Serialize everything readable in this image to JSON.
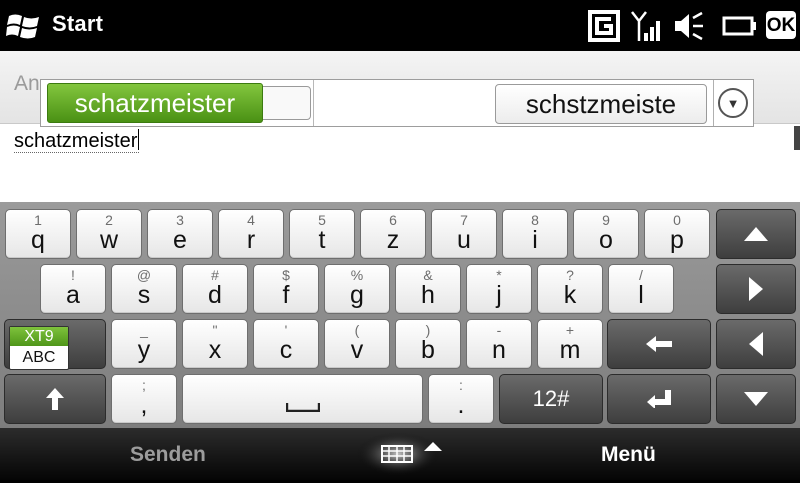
{
  "statusbar": {
    "title": "Start",
    "icons": [
      "windows-start-icon",
      "gprs-icon",
      "signal-strength-icon",
      "speaker-muted-icon",
      "battery-icon",
      "ok-button"
    ],
    "ok_label": "OK"
  },
  "recipient": {
    "label": "An",
    "suggestion_primary": "schatzmeister",
    "suggestion_secondary": "schstzmeiste",
    "more_icon": "chevron-down-circle-icon"
  },
  "message": {
    "text": "schatzmeister"
  },
  "keyboard": {
    "rows": [
      [
        {
          "name": "q",
          "sec": "1",
          "pri": "q"
        },
        {
          "name": "w",
          "sec": "2",
          "pri": "w"
        },
        {
          "name": "e",
          "sec": "3",
          "pri": "e"
        },
        {
          "name": "r",
          "sec": "4",
          "pri": "r"
        },
        {
          "name": "t",
          "sec": "5",
          "pri": "t"
        },
        {
          "name": "z",
          "sec": "6",
          "pri": "z"
        },
        {
          "name": "u",
          "sec": "7",
          "pri": "u"
        },
        {
          "name": "i",
          "sec": "8",
          "pri": "i"
        },
        {
          "name": "o",
          "sec": "9",
          "pri": "o"
        },
        {
          "name": "p",
          "sec": "0",
          "pri": "p"
        }
      ],
      [
        {
          "name": "a",
          "sec": "!",
          "pri": "a"
        },
        {
          "name": "s",
          "sec": "@",
          "pri": "s"
        },
        {
          "name": "d",
          "sec": "#",
          "pri": "d"
        },
        {
          "name": "f",
          "sec": "$",
          "pri": "f"
        },
        {
          "name": "g",
          "sec": "%",
          "pri": "g"
        },
        {
          "name": "h",
          "sec": "&",
          "pri": "h"
        },
        {
          "name": "j",
          "sec": "*",
          "pri": "j"
        },
        {
          "name": "k",
          "sec": "?",
          "pri": "k"
        },
        {
          "name": "l",
          "sec": "/",
          "pri": "l"
        }
      ],
      [
        {
          "name": "y",
          "sec": "_",
          "pri": "y"
        },
        {
          "name": "x",
          "sec": "\"",
          "pri": "x"
        },
        {
          "name": "c",
          "sec": "'",
          "pri": "c"
        },
        {
          "name": "v",
          "sec": "(",
          "pri": "v"
        },
        {
          "name": "b",
          "sec": ")",
          "pri": "b"
        },
        {
          "name": "n",
          "sec": "-",
          "pri": "n"
        },
        {
          "name": "m",
          "sec": "+",
          "pri": "m"
        }
      ]
    ],
    "bottom_row": {
      "comma": {
        "sec": ";",
        "pri": ","
      },
      "period": {
        "sec": ":",
        "pri": "."
      },
      "numbers_label": "12#"
    },
    "xt9": {
      "top": "XT9",
      "bottom": "ABC"
    },
    "control_icons": [
      "arrow-up-icon",
      "arrow-right-icon",
      "arrow-left-icon",
      "arrow-down-icon",
      "shift-icon",
      "backspace-icon",
      "enter-icon",
      "space-icon"
    ],
    "accent": "#5aa320"
  },
  "bottombar": {
    "left_softkey": "Senden",
    "right_softkey": "Menü",
    "center_icon": "keyboard-toggle-icon"
  }
}
